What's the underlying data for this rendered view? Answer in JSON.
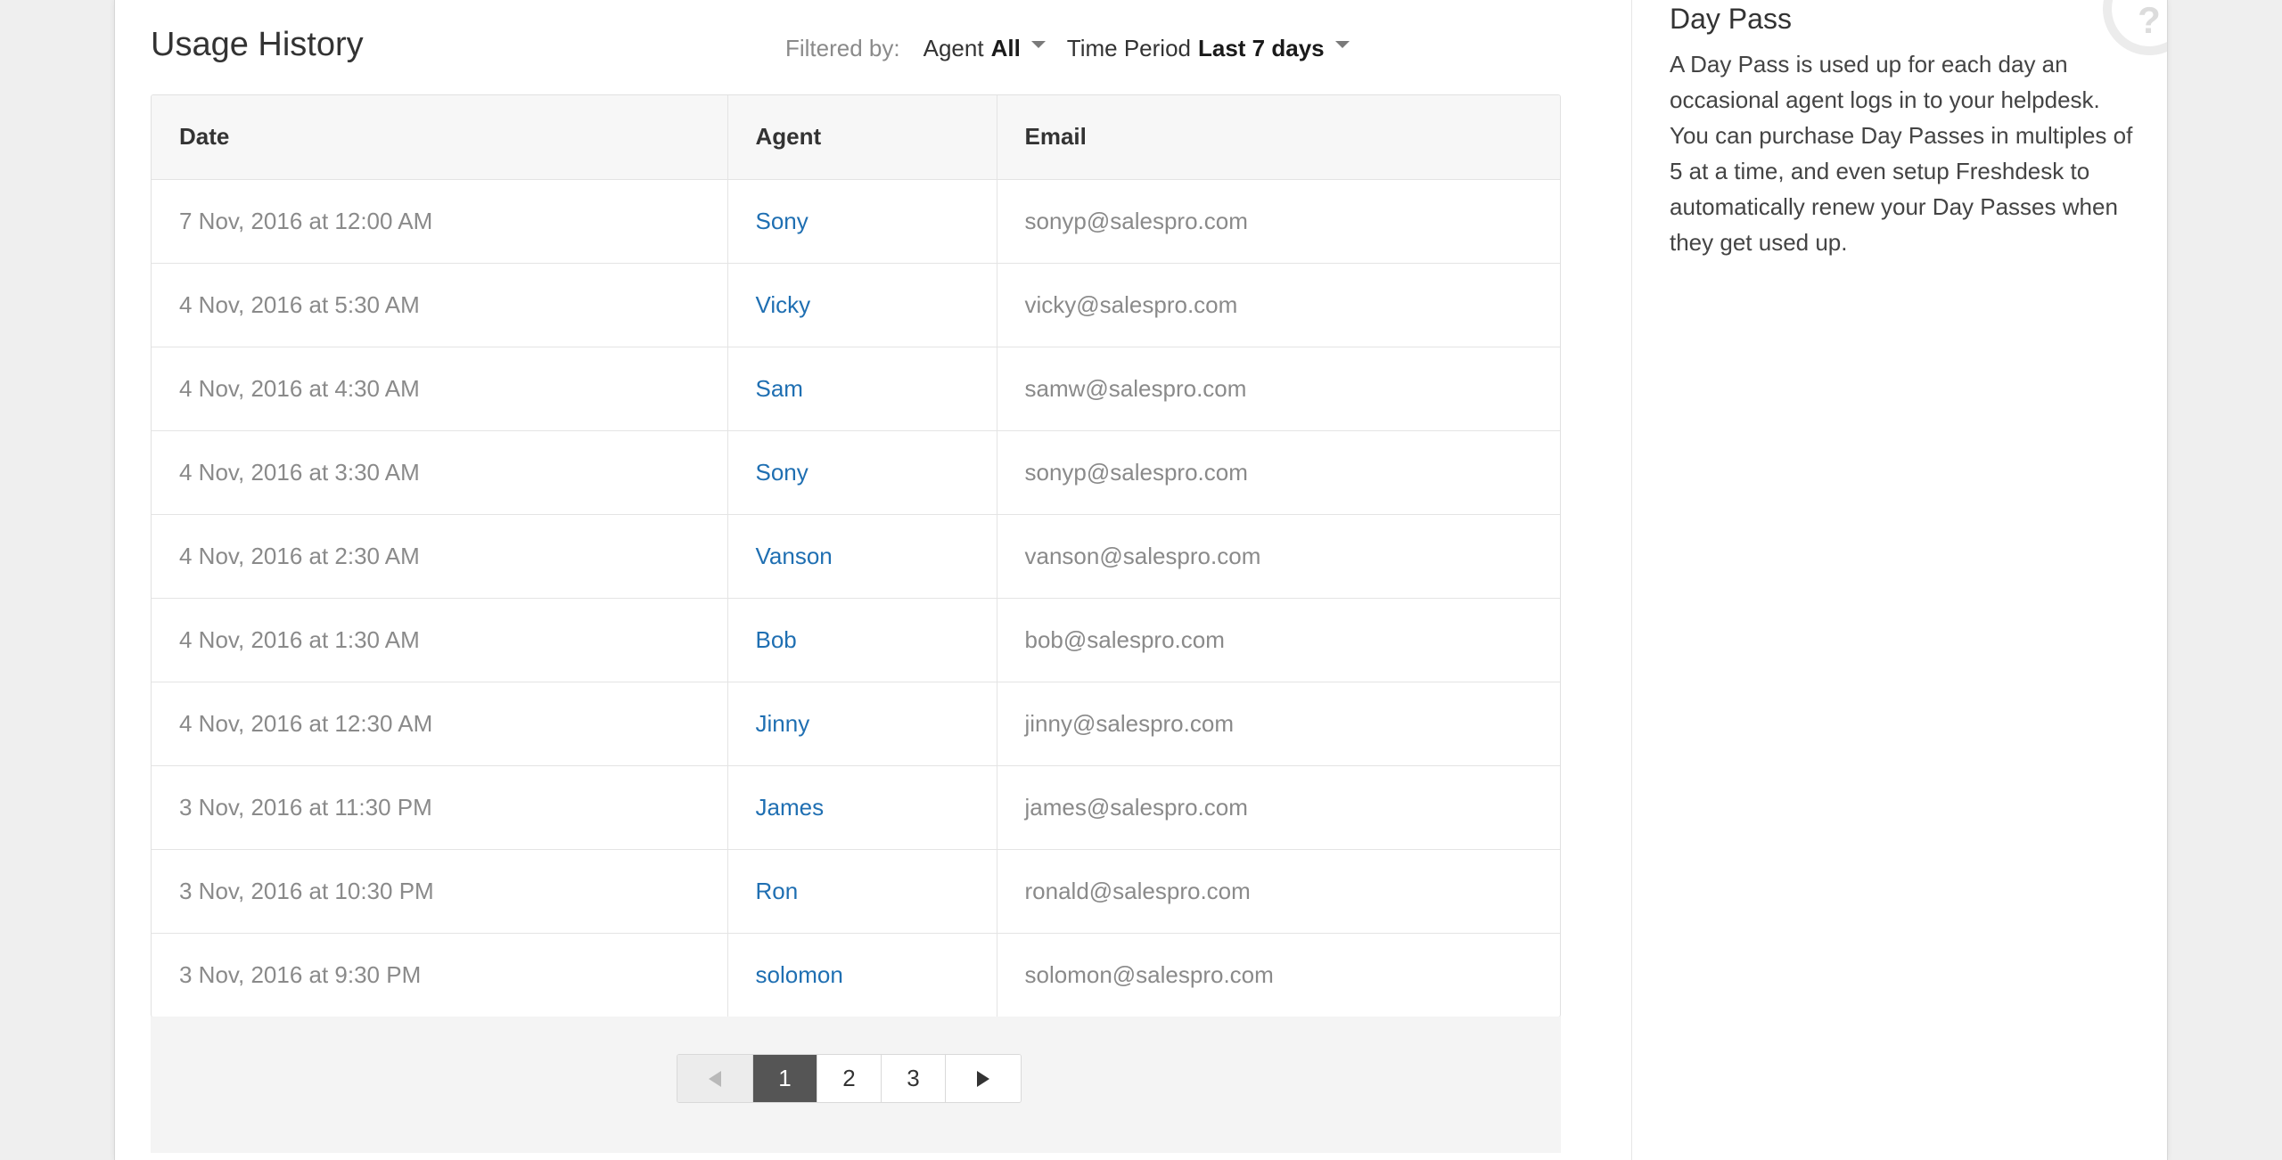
{
  "header": {
    "title": "Usage History",
    "filtered_by_label": "Filtered by:",
    "filters": {
      "agent": {
        "label": "Agent",
        "value": "All"
      },
      "time_period": {
        "label": "Time Period",
        "value": "Last 7 days"
      }
    }
  },
  "table": {
    "columns": [
      "Date",
      "Agent",
      "Email"
    ],
    "rows": [
      {
        "date": "7 Nov, 2016 at 12:00 AM",
        "agent": "Sony",
        "email": "sonyp@salespro.com"
      },
      {
        "date": "4 Nov, 2016 at 5:30 AM",
        "agent": "Vicky",
        "email": "vicky@salespro.com"
      },
      {
        "date": "4 Nov, 2016 at 4:30 AM",
        "agent": "Sam",
        "email": "samw@salespro.com"
      },
      {
        "date": "4 Nov, 2016 at 3:30 AM",
        "agent": "Sony",
        "email": "sonyp@salespro.com"
      },
      {
        "date": "4 Nov, 2016 at 2:30 AM",
        "agent": "Vanson",
        "email": "vanson@salespro.com"
      },
      {
        "date": "4 Nov, 2016 at 1:30 AM",
        "agent": "Bob",
        "email": "bob@salespro.com"
      },
      {
        "date": "4 Nov, 2016 at 12:30 AM",
        "agent": "Jinny",
        "email": "jinny@salespro.com"
      },
      {
        "date": "3 Nov, 2016 at 11:30 PM",
        "agent": "James",
        "email": "james@salespro.com"
      },
      {
        "date": "3 Nov, 2016 at 10:30 PM",
        "agent": "Ron",
        "email": "ronald@salespro.com"
      },
      {
        "date": "3 Nov, 2016 at 9:30 PM",
        "agent": "solomon",
        "email": "solomon@salespro.com"
      }
    ]
  },
  "pagination": {
    "pages": [
      "1",
      "2",
      "3"
    ],
    "current_page": "1",
    "prev_icon": "triangle-left-icon",
    "next_icon": "triangle-right-icon"
  },
  "sidebar": {
    "title": "Day Pass",
    "description": "A Day Pass is used up for each day an occasional agent logs in to your helpdesk. You can purchase Day Passes in multiples of 5 at a time, and even setup Freshdesk to automatically renew your Day Passes when they get used up.",
    "help_icon": "?"
  },
  "colors": {
    "link": "#1f6fb2",
    "muted_text": "#8a8a8a",
    "active_page_bg": "#555555",
    "page_background": "#efefef"
  }
}
